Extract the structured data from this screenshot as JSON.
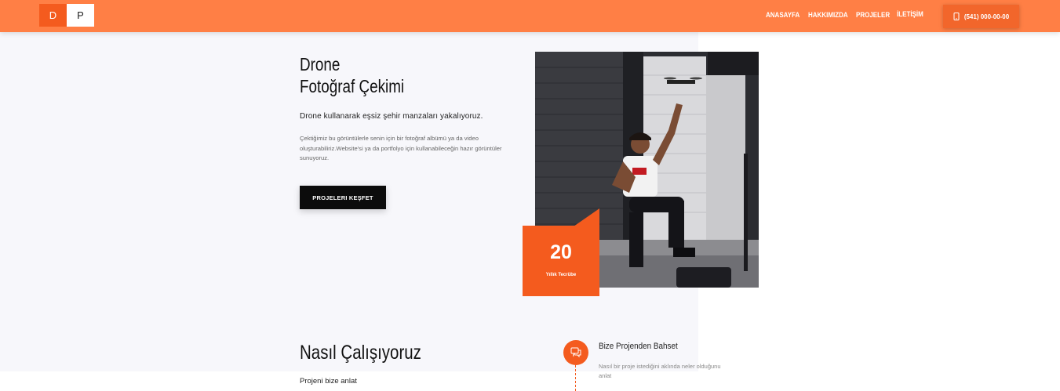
{
  "header": {
    "logo_left": "D",
    "logo_right": "P",
    "nav": [
      "ANASAYFA",
      "HAKKIMIZDA",
      "PROJELER",
      "İLETİŞİM"
    ],
    "phone": "(541) 000-00-00",
    "accent": "#ff7f45"
  },
  "hero": {
    "title_line1": "Drone",
    "title_line2": "Fotoğraf Çekimi",
    "subtitle": "Drone kullanarak eşsiz şehir manzaları yakalıyoruz.",
    "description": "Çektiğimiz bu görüntülerle senin için bir fotoğraf albümü ya da video oluşturabiliriz.Website'si ya da portfolyo için kullanabileceğin hazır görüntüler sunuyoruz.",
    "cta": "PROJELERI KEŞFET",
    "experience_number": "20",
    "experience_label": "Yıllık Tecrübe"
  },
  "how": {
    "title": "Nasıl Çalışıyoruz",
    "subtitle": "Projeni bize anlat",
    "step_title": "Bize Projenden Bahset",
    "step_desc": "Nasıl bir proje istediğini aklında neler olduğunu anlat"
  }
}
